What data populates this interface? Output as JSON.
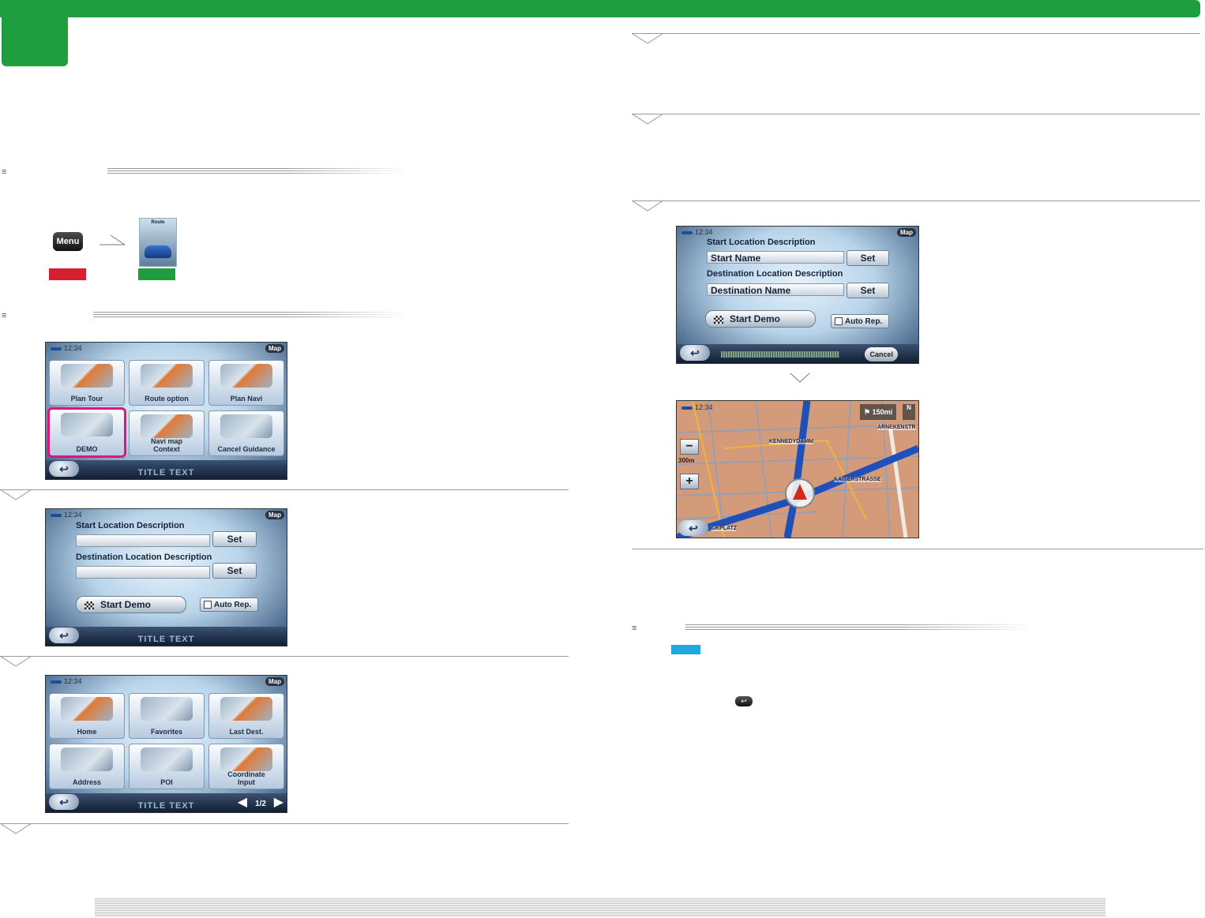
{
  "colors": {
    "brand_green": "#1f9e3f",
    "highlight_magenta": "#e0147e",
    "red_label": "#d42030",
    "blue_label": "#22a8e0"
  },
  "menu_step": {
    "menu_button": "Menu",
    "route_icon_label": "Route",
    "arrow": "→"
  },
  "screen1": {
    "clock": "12:34",
    "map_button": "Map",
    "tiles": [
      "Plan Tour",
      "Route option",
      "Plan Navi",
      "DEMO",
      "Navi map Context",
      "Cancel Guidance"
    ],
    "title": "TITLE TEXT"
  },
  "screen2": {
    "clock": "12:34",
    "map_button": "Map",
    "start_desc": "Start Location Description",
    "dest_desc": "Destination Location Description",
    "set_label": "Set",
    "start_demo": "Start Demo",
    "auto_rep": "Auto Rep.",
    "title": "TITLE TEXT"
  },
  "screen3": {
    "clock": "12:34",
    "map_button": "Map",
    "tiles": [
      "Home",
      "Favorites",
      "Last Dest.",
      "Address",
      "POI",
      "Coordinate Input"
    ],
    "title": "TITLE TEXT",
    "page": "1/2"
  },
  "screen4": {
    "clock": "12:34",
    "map_button": "Map",
    "start_desc": "Start Location Description",
    "start_name": "Start Name",
    "dest_desc": "Destination Location Description",
    "dest_name": "Destination Name",
    "set_label": "Set",
    "start_demo": "Start Demo",
    "auto_rep": "Auto Rep.",
    "cancel": "Cancel"
  },
  "map_screen": {
    "clock": "12:34",
    "distance": "150mi",
    "north": "N",
    "scale": "300m",
    "zoom_out": "−",
    "zoom_in": "+",
    "streets": [
      "KENNEDYDAMM",
      "ARNEKENSTR",
      "KAISERSTRASSE",
      "CKPLATZ"
    ]
  }
}
